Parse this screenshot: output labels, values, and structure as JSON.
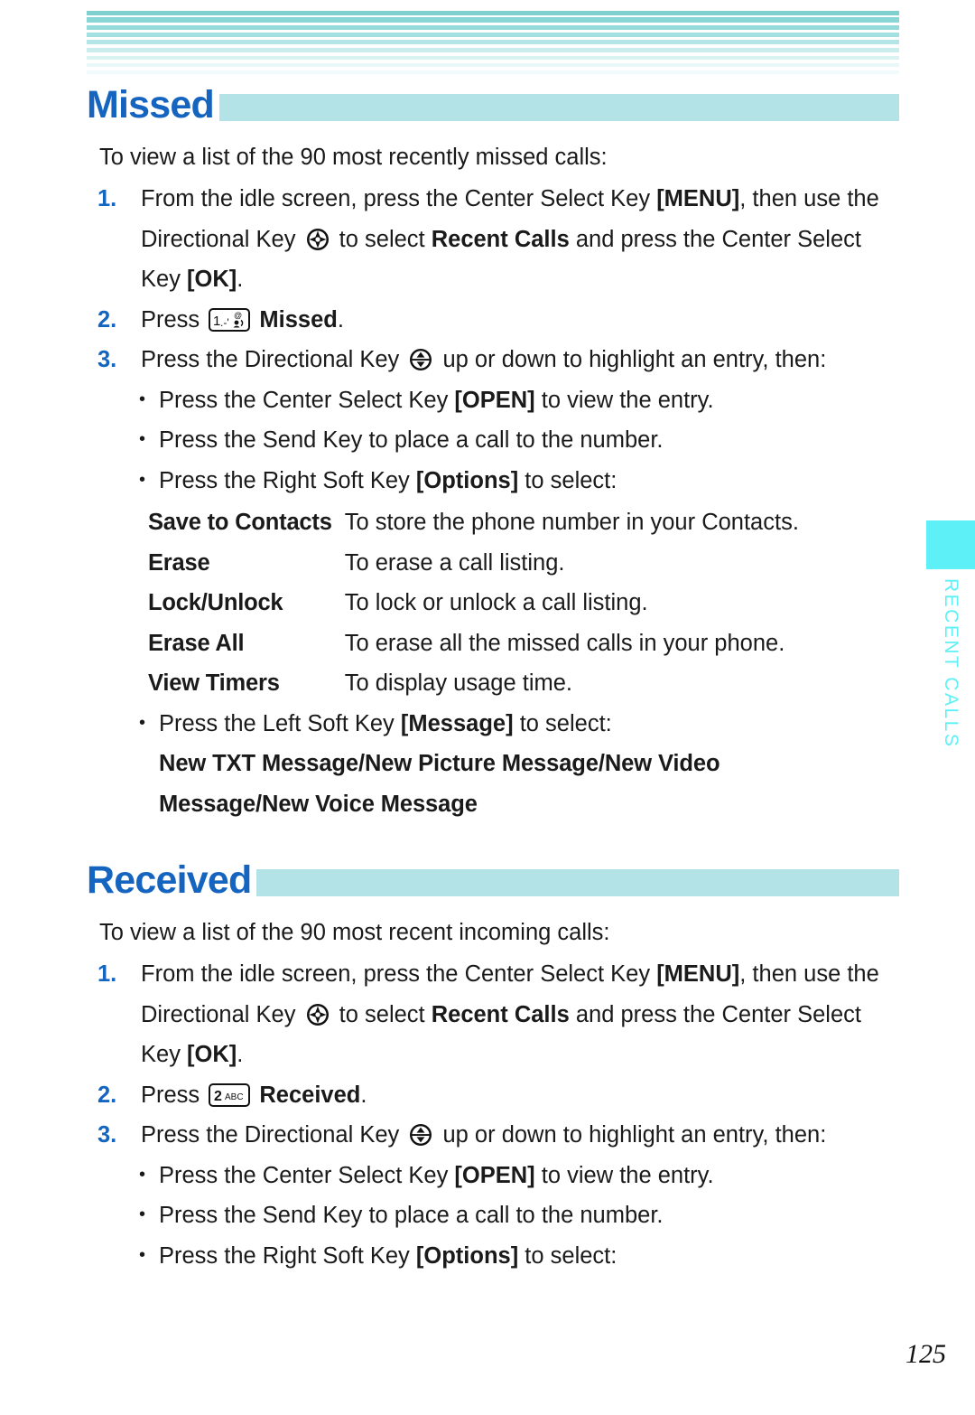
{
  "document": {
    "page_number": "125",
    "colors": {
      "heading_blue": "#1565c0",
      "heading_bar_teal": "#b3e3e6",
      "side_tab_cyan": "#5ef0f7",
      "stripe_top": "#7fd4d4"
    }
  },
  "side_tab": {
    "label": "RECENT CALLS"
  },
  "sections": [
    {
      "id": "missed",
      "heading": "Missed",
      "intro": "To view a list of the 90 most recently missed calls:",
      "steps": [
        {
          "number": "1.",
          "parts": [
            "From the idle screen, press the Center Select Key ",
            "[MENU]",
            ", then use the Directional Key ",
            "4way-directional-key-icon",
            " to select ",
            "Recent Calls",
            " and press the Center Select Key ",
            "[OK]",
            "."
          ],
          "text_plain": "From the idle screen, press the Center Select Key [MENU], then use the Directional Key to select Recent Calls and press the Center Select Key [OK]."
        },
        {
          "number": "2.",
          "prefix": "Press",
          "key_icon": "key-1-voicemail-icon",
          "bold_label": "Missed",
          "suffix": "."
        },
        {
          "number": "3.",
          "prefix": "Press the Directional Key",
          "key_icon": "updown-directional-key-icon",
          "suffix": "up or down to highlight an entry, then:"
        }
      ],
      "bullets": [
        {
          "before": "Press the Center Select Key ",
          "bold": "[OPEN]",
          "after": " to view the entry."
        },
        {
          "before": "Press the Send Key to place a call to the number.",
          "bold": "",
          "after": ""
        },
        {
          "before": "Press the Right Soft Key ",
          "bold": "[Options]",
          "after": " to select:"
        }
      ],
      "options_table": [
        {
          "term": "Save to Contacts",
          "desc": "To store the phone number in your Contacts."
        },
        {
          "term": "Erase",
          "desc": "To erase a call listing."
        },
        {
          "term": "Lock/Unlock",
          "desc": "To lock or unlock a call listing."
        },
        {
          "term": "Erase All",
          "desc": "To erase all the missed calls in your phone."
        },
        {
          "term": "View Timers",
          "desc": "To display usage time."
        }
      ],
      "message_bullet": {
        "before": "Press the Left Soft Key ",
        "bold": "[Message]",
        "after": " to select:"
      },
      "message_options_line1": "New TXT Message/New Picture Message/New Video",
      "message_options_line2": "Message/New Voice Message"
    },
    {
      "id": "received",
      "heading": "Received",
      "intro": "To view a list of the 90 most recent incoming calls:",
      "steps": [
        {
          "number": "1.",
          "text_plain": "From the idle screen, press the Center Select Key [MENU], then use the Directional Key to select Recent Calls and press the Center Select Key [OK]."
        },
        {
          "number": "2.",
          "prefix": "Press",
          "key_icon": "key-2-abc-icon",
          "bold_label": "Received",
          "suffix": "."
        },
        {
          "number": "3.",
          "prefix": "Press the Directional Key",
          "key_icon": "updown-directional-key-icon",
          "suffix": "up or down to highlight an entry, then:"
        }
      ],
      "bullets": [
        {
          "before": "Press the Center Select Key ",
          "bold": "[OPEN]",
          "after": " to view the entry."
        },
        {
          "before": "Press the Send Key to place a call to the number.",
          "bold": "",
          "after": ""
        },
        {
          "before": "Press the Right Soft Key ",
          "bold": "[Options]",
          "after": " to select:"
        }
      ]
    }
  ],
  "fragments": {
    "step1_a": "From the idle screen, press the Center Select Key ",
    "step1_menu": "[MENU]",
    "step1_b": ", then use the Directional Key ",
    "step1_c": " to select ",
    "step1_recent_calls": "Recent Calls",
    "step1_d": " and press the Center Select Key ",
    "step1_ok": "[OK]",
    "step1_e": ".",
    "press_word": "Press",
    "missed_bold": "Missed",
    "received_bold": "Received",
    "period": ".",
    "dir_prefix": "Press the Directional Key",
    "dir_suffix": "up or down to highlight an entry,",
    "then_word": "then:"
  },
  "key_icons": {
    "key_1": {
      "name": "key-1-voicemail-icon",
      "primary": "1",
      "secondary": ".-'"
    },
    "key_2": {
      "name": "key-2-abc-icon",
      "primary": "2",
      "secondary": "ABC"
    }
  }
}
